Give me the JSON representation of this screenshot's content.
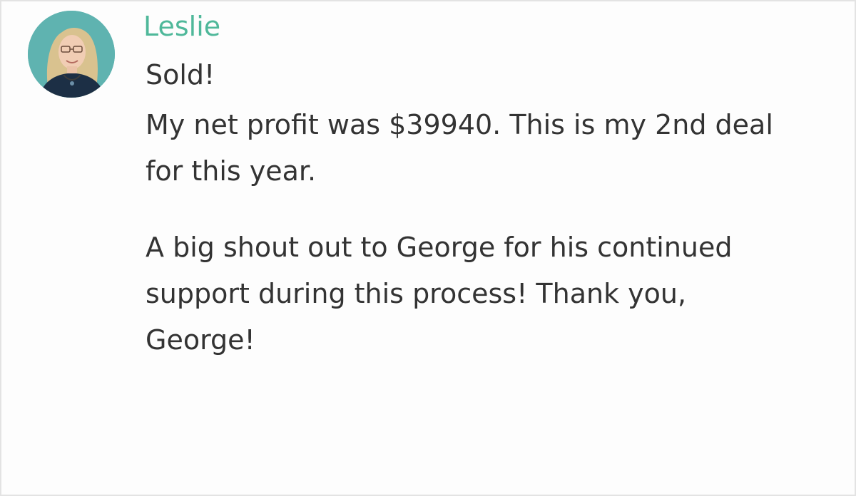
{
  "message": {
    "author": "Leslie",
    "avatar_icon": "profile-photo",
    "accent_color": "#4fb89a",
    "lines": {
      "l1": "Sold!",
      "l2": "My net profit was $39940. This is my 2nd deal",
      "l3": "for this year.",
      "l4": "A big shout out to George for his continued",
      "l5": "support during this process! Thank you,",
      "l6": "George!"
    }
  }
}
